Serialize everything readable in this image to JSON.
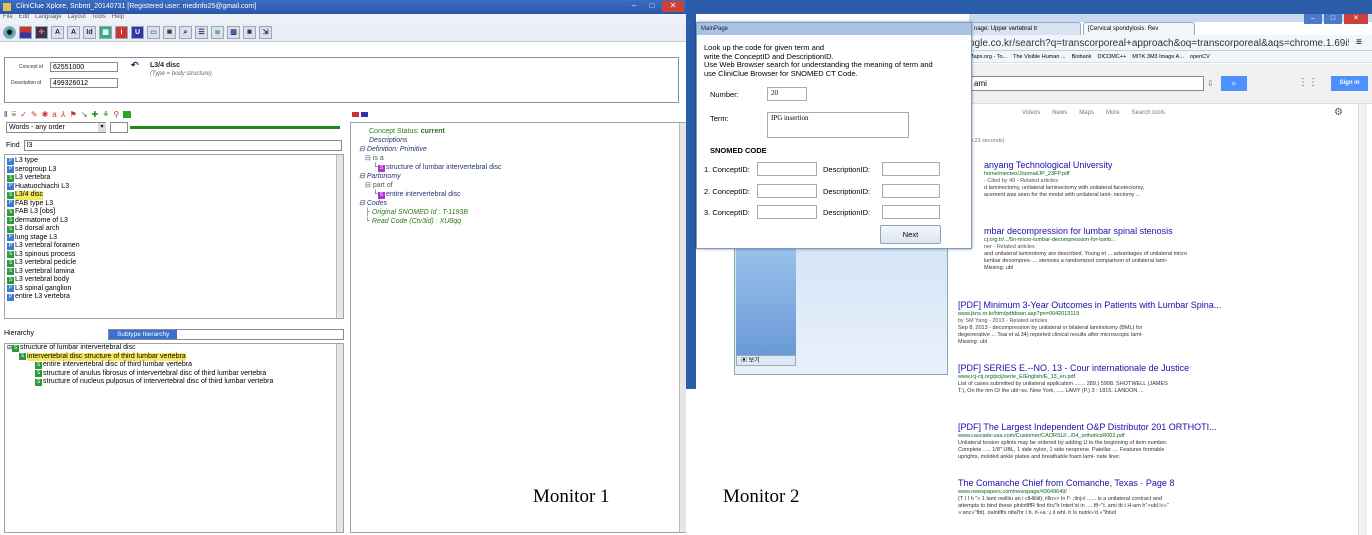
{
  "monitor1": {
    "label": "Monitor 1",
    "window_title": "CliniClue Xplore, Snbmt_20140731 [Registered user: medinfo25@gmail.com]",
    "menu": [
      "File",
      "Edit",
      "Language",
      "Layout",
      "Tools",
      "Help"
    ],
    "concept_id_label": "Concept id",
    "concept_id": "62551000",
    "description_id_label": "Description id",
    "description_id": "499326012",
    "term_title": "L3/4 disc",
    "term_type": "(Type = body structure)",
    "search_mode": "Words - any order",
    "find_label": "Find",
    "find_value": "l3",
    "results": [
      {
        "badge": "P",
        "text": "L3 type"
      },
      {
        "badge": "P",
        "text": "serogroup L3"
      },
      {
        "badge": "S",
        "text": "L3 vertebra"
      },
      {
        "badge": "P",
        "text": "Huatuochiachi L3"
      },
      {
        "badge": "S",
        "text": "L3/4 disc"
      },
      {
        "badge": "P",
        "text": "FAB type L3"
      },
      {
        "badge": "S",
        "text": "FAB L3 [obs]"
      },
      {
        "badge": "S",
        "text": "dermatome of L3"
      },
      {
        "badge": "S",
        "text": "L3 dorsal arch"
      },
      {
        "badge": "P",
        "text": "lung stage L3"
      },
      {
        "badge": "P",
        "text": "L3 vertebral foramen"
      },
      {
        "badge": "S",
        "text": "L3 spinous process"
      },
      {
        "badge": "S",
        "text": "L3 vertebral pedicle"
      },
      {
        "badge": "S",
        "text": "L3 vertebral lamina"
      },
      {
        "badge": "S",
        "text": "L3 vertebral body"
      },
      {
        "badge": "P",
        "text": "L3 spinal ganglion"
      },
      {
        "badge": "P",
        "text": "entire L3 vertebra"
      }
    ],
    "hierarchy_label": "Hierarchy",
    "hierarchy_select": "Subtype hierarchy",
    "hierarchy": [
      "structure of lumbar intervertebral disc",
      "intervertebral disc structure of third lumbar vertebra",
      "entire intervertebral disc of third lumbar vertebra",
      "structure of anulus fibrosus of intervertebral disc of third lumbar vertebra",
      "structure of nucleus pulposus of intervertebral disc of third lumbar vertebra"
    ],
    "concept_status_label": "Concept Status:",
    "concept_status": "current",
    "details": {
      "descriptions": "Descriptions",
      "definition": "Definition: Primitive",
      "is_a": "is a",
      "is_a_target": "structure of lumbar intervertebral disc",
      "partonomy": "Partonomy",
      "part_of": "part of",
      "part_of_target": "entire intervertebral disc",
      "codes": "Codes",
      "original": "Original SNOMED Id : T-1193B",
      "read_code": "Read Code (Ctv3id) : XU8qq"
    }
  },
  "monitor2": {
    "label": "Monitor 2",
    "tabs": [
      "nage: Upper vertebral tr",
      "[Cervical spondylosis. Rev"
    ],
    "address": "ogle.co.kr/search?q=transcorporeal+approach&oq=transcorporeal&aqs=chrome.1.69i5",
    "bookmarks": [
      "Maps.org - To...",
      "The Visible Human ...",
      "Biobank",
      "DICOMC++",
      "MITK 3M3 Image A...",
      "openCV"
    ],
    "search_query": "ami",
    "sign_in": "Sign in",
    "search_tabs": [
      "Videos",
      "News",
      "Maps",
      "More",
      "Search tools"
    ],
    "result_stats": "ults (0.23 seconds)",
    "taskbar_label": "보기",
    "results": [
      {
        "title": "anyang Technological University",
        "url": "home/mecteo/Journal/JP_23FP.pdf",
        "meta": "- Cited by 49 - Related articles",
        "snippet": [
          "d laminectomy, unilateral laminectomy with unilateral facetectomy,",
          "acement was seen for the model with unilateral lami- nectomy ..."
        ]
      },
      {
        "title": "mbar decompression for lumbar spinal stenosis",
        "url": "cj.org.tr/.../5n-micro-lumbar-decompression-for-lumb...",
        "meta": "ner - Related articles",
        "snippet": [
          "and unilateral laminotomy are described. Young et ... advantages of unilateral micro",
          "lumbar decompres- ... stenosis a randomized comparison of unilateral lami-",
          "Missing: ubl"
        ]
      },
      {
        "title": "[PDF] Minimum 3-Year Outcomes in Patients with Lumbar Spina...",
        "url": "www.jkns.or.kr/htm/pdfdown.asp?pn=0042013119",
        "meta": "by SM Yang - 2013 - Related articles",
        "snippet": [
          "Sep 8, 2013 - decompression by unilateral or bilateral laminotomy (BML) for",
          "degenerative ... Tsai et al.34) reported clinical results after microscopic lami-",
          "Missing: ubl"
        ]
      },
      {
        "title": "[PDF] SERIES E.--NO. 13 - Cour internationale de Justice",
        "url": "www.icj-cij.org/pcij/serie_E/English/E_13_en.pdf",
        "meta": "",
        "snippet": [
          "List of cases submitted by unilateral application ....... 289.) 5998. SHOTWELL (JAMES",
          "T.), On the rim O/ the ubl~ss. New York, ..... LAMY (P.) 3 : 1815. LANDON ..."
        ]
      },
      {
        "title": "[PDF] The Largest Independent O&P Distributor 201 ORTHOTI...",
        "url": "www.cascade-usa.com/Customer/CAORSU/.../04_orthoticsR002.pdf",
        "meta": "",
        "snippet": [
          "Unilateral torsion splints may be ordered by adding U to the beginning of item number.",
          "Complete ..... 1/8\" UBL, 1 side nylon, 1 side neoprene. Patellar .... Features formable",
          "uprights, molded ankle plates and breathable foam lami- nate liner."
        ]
      },
      {
        "title": "The Comanche Chief from Comanche, Texas · Page 8",
        "url": "www.newspapers.com/newspage/43649649/",
        "meta": "",
        "snippet": [
          "(T I I h \"« 1 lami owlliiu an i clHliliil); iilln»> In f'- ;linj»l ...... is a unilateral contract and",
          "attempts to bind these plnlntlffR find tlru\"lr Intert'st in .... ffl~\"t. ami tb t H-am h\">ubl l»»\"",
          "»:anc»\"fbt(. rialntlffs ntlal'hr I b. rl-»a :,i il whl. h Is nutrk»'d »\"lhtuit"
        ]
      }
    ],
    "dialog": {
      "title": "MainPage",
      "instructions": [
        "Look up the code for given term and",
        "write the ConceptID and DescriptionID.",
        "Use Web Browser search for understanding the meaning of term and",
        "use CliniClue Browser for SNOMED CT Code."
      ],
      "number_label": "Number:",
      "number_value": "20",
      "term_label": "Term:",
      "term_value": "IPG insertion",
      "snomed_heading": "SNOMED CODE",
      "rows": [
        {
          "concept_label": "1. ConceptID:",
          "desc_label": "DescriptionID:"
        },
        {
          "concept_label": "2. ConceptID:",
          "desc_label": "DescriptionID:"
        },
        {
          "concept_label": "3. ConceptID:",
          "desc_label": "DescriptionID:"
        }
      ],
      "next_label": "Next"
    }
  }
}
